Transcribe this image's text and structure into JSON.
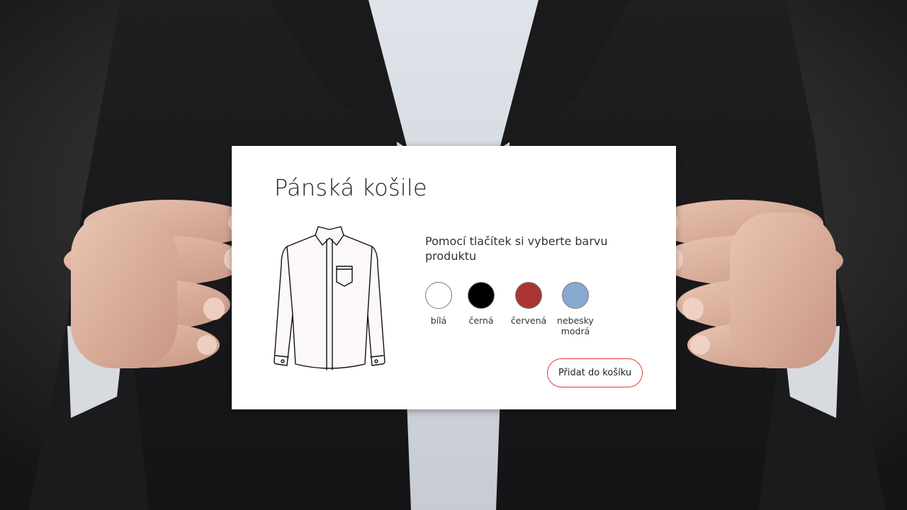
{
  "product": {
    "title": "Pánská košile",
    "instruction": "Pomocí tlačítek si vyberte barvu produktu",
    "colors": [
      {
        "label": "bílá",
        "hex": "#ffffff"
      },
      {
        "label": "černá",
        "hex": "#000000"
      },
      {
        "label": "červená",
        "hex": "#a93532"
      },
      {
        "label": "nebesky modrá",
        "hex": "#87a9cf"
      }
    ],
    "add_to_cart_label": "Přidat do košíku",
    "shirt_icon": "shirt-icon",
    "accent_color": "#e33b3b"
  }
}
